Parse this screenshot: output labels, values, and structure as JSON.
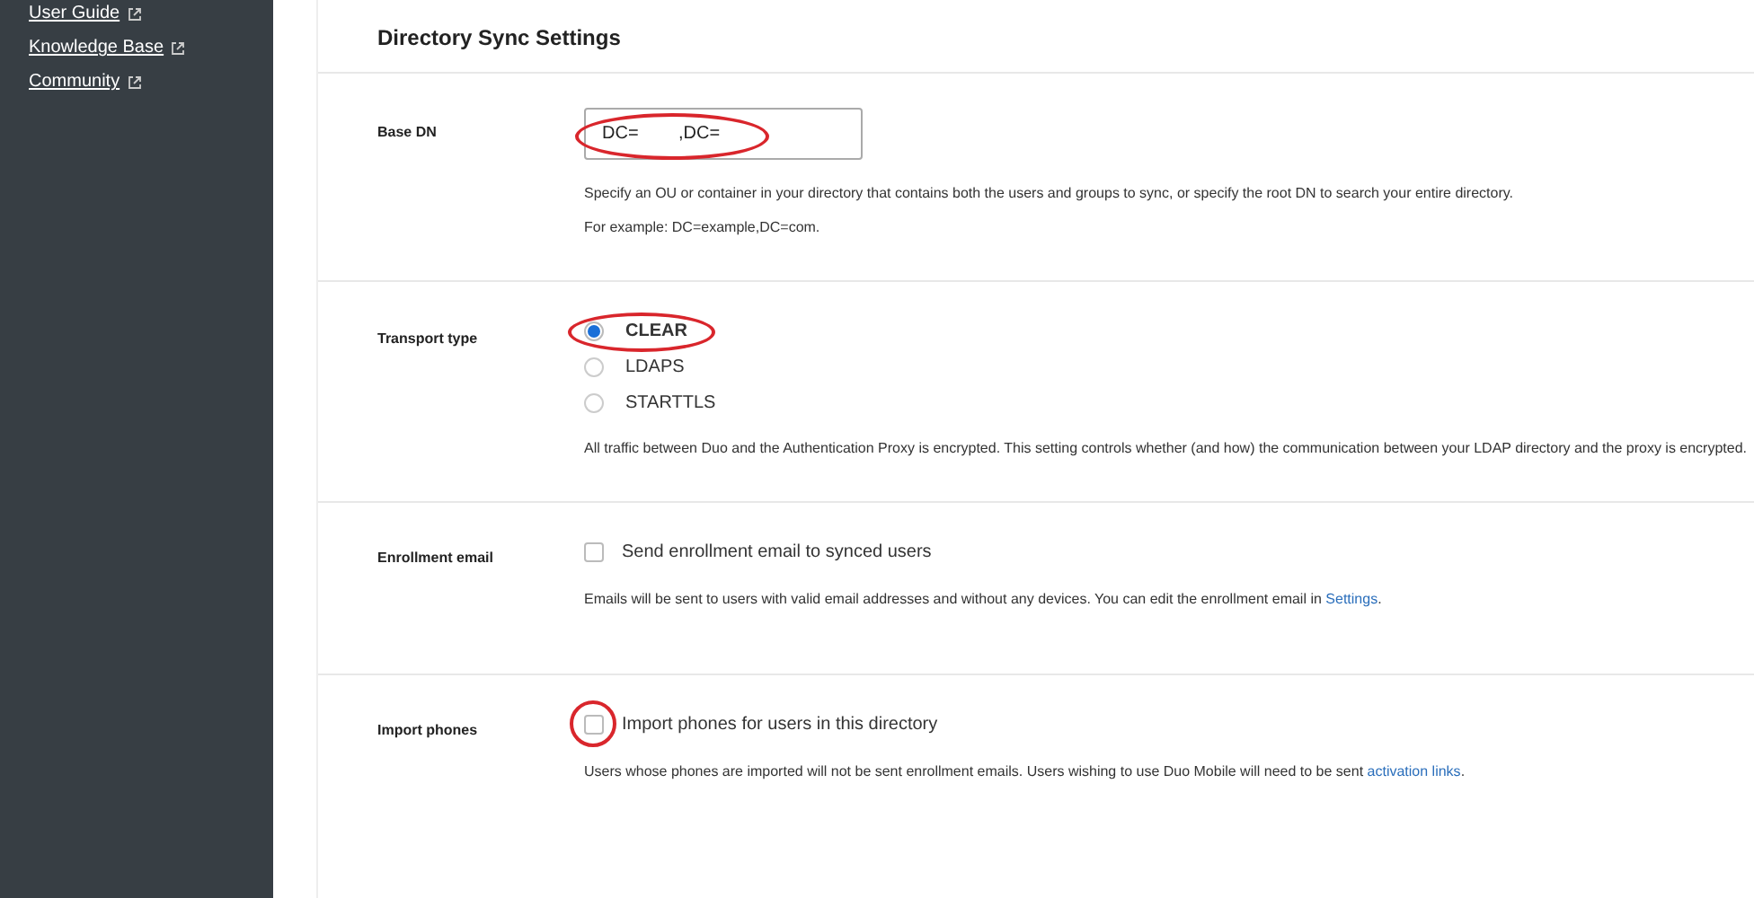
{
  "sidebar": {
    "links": [
      {
        "label": "User Guide"
      },
      {
        "label": "Knowledge Base"
      },
      {
        "label": "Community"
      }
    ]
  },
  "title": "Directory Sync Settings",
  "sections": [
    {
      "kind": "text",
      "label": "Base DN",
      "value": "DC=        ,DC=",
      "annotated": true,
      "help": [
        "Specify an OU or container in your directory that contains both the users and groups to sync, or specify the root DN to search your entire directory.",
        "For example: DC=example,DC=com."
      ]
    },
    {
      "kind": "radio",
      "label": "Transport type",
      "options": [
        {
          "label": "CLEAR",
          "selected": true,
          "annotated": true
        },
        {
          "label": "LDAPS",
          "selected": false,
          "annotated": false
        },
        {
          "label": "STARTTLS",
          "selected": false,
          "annotated": false
        }
      ],
      "help": [
        "All traffic between Duo and the Authentication Proxy is encrypted. This setting controls whether (and how) the communication between your LDAP directory and the proxy is encrypted."
      ]
    },
    {
      "kind": "checkbox",
      "label": "Enrollment email",
      "checkbox": {
        "label": "Send enrollment email to synced users",
        "checked": false,
        "annotated": false
      },
      "help": [
        "Emails will be sent to users with valid email addresses and without any devices. You can edit the enrollment email in "
      ],
      "link": "Settings",
      "after": "."
    },
    {
      "kind": "checkbox",
      "label": "Import phones",
      "checkbox": {
        "label": "Import phones for users in this directory",
        "checked": false,
        "annotated": true
      },
      "help": [
        "Users whose phones are imported will not be sent enrollment emails. Users wishing to use Duo Mobile will need to be sent "
      ],
      "link": "activation links",
      "after": "."
    }
  ]
}
